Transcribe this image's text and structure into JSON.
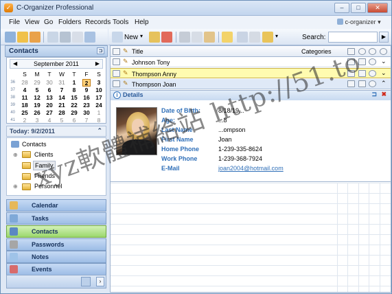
{
  "window": {
    "title": "C-Organizer Professional"
  },
  "window_buttons": {
    "minimize": "–",
    "maximize": "□",
    "close": "✕"
  },
  "menu": [
    "File",
    "View",
    "Go",
    "Folders",
    "Records",
    "Tools",
    "Help"
  ],
  "database_selector": {
    "value": "c-organizer"
  },
  "toolbar": {
    "new_label": "New",
    "search_label": "Search:"
  },
  "contacts_panel": {
    "title": "Contacts"
  },
  "calendar": {
    "month_label": "September 2011",
    "weekday_headers": [
      "S",
      "M",
      "T",
      "W",
      "T",
      "F",
      "S"
    ],
    "week_numbers": [
      "36",
      "37",
      "38",
      "39",
      "40",
      "41"
    ],
    "weeks": [
      [
        "28",
        "29",
        "30",
        "31",
        "1",
        "2",
        "3"
      ],
      [
        "4",
        "5",
        "6",
        "7",
        "8",
        "9",
        "10"
      ],
      [
        "11",
        "12",
        "13",
        "14",
        "15",
        "16",
        "17"
      ],
      [
        "18",
        "19",
        "20",
        "21",
        "22",
        "23",
        "24"
      ],
      [
        "25",
        "26",
        "27",
        "28",
        "29",
        "30",
        "1"
      ],
      [
        "2",
        "3",
        "4",
        "5",
        "6",
        "7",
        "8"
      ]
    ],
    "selected_day": "2"
  },
  "today_label": "Today: 9/2/2011",
  "tree": {
    "root": "Contacts",
    "children": [
      "Clients",
      "Family",
      "Friends",
      "Personnel"
    ]
  },
  "nav": [
    "Calendar",
    "Tasks",
    "Contacts",
    "Passwords",
    "Notes",
    "Events"
  ],
  "grid": {
    "columns": {
      "title": "Title",
      "categories": "Categories"
    },
    "rows": [
      "Johnson Tony",
      "Thompson Anny",
      "Thompson Joan"
    ]
  },
  "details": {
    "header": "Details",
    "fields": [
      {
        "label": "Date of Birth:",
        "value": "8/18/19..."
      },
      {
        "label": "Age:",
        "value": "...8"
      },
      {
        "label": "Last Name",
        "value": "...ompson"
      },
      {
        "label": "First Name",
        "value": "Joan"
      },
      {
        "label": "Home Phone",
        "value": "1-239-335-8624"
      },
      {
        "label": "Work Phone",
        "value": "1-239-368-7924"
      },
      {
        "label": "E-Mail",
        "value": "joan2004@hotmail.com"
      }
    ]
  },
  "watermark": "xyz軟體補給站 http://51.to",
  "colors": {
    "accent": "#2f6fb8",
    "selected_row": "#fffbb0",
    "active_nav": "#9bd86c"
  }
}
